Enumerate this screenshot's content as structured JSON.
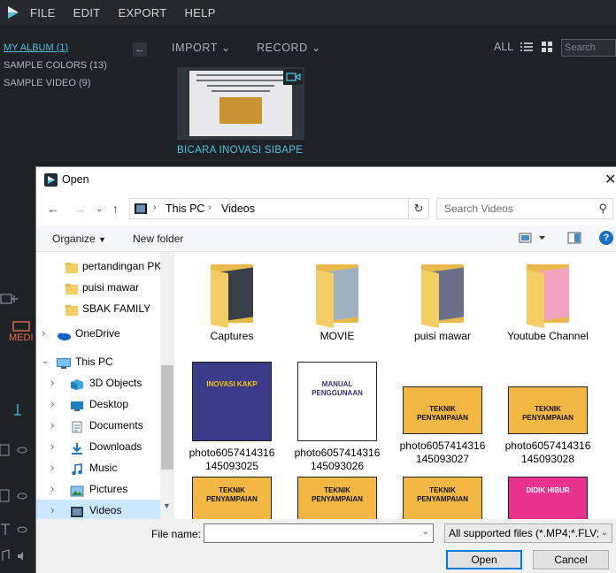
{
  "menubar": {
    "items": [
      "FILE",
      "EDIT",
      "EXPORT",
      "HELP"
    ]
  },
  "library": {
    "items": [
      {
        "label": "MY ALBUM (1)",
        "active": true
      },
      {
        "label": "SAMPLE COLORS (13)",
        "active": false
      },
      {
        "label": "SAMPLE VIDEO (9)",
        "active": false
      }
    ]
  },
  "media": {
    "import_label": "IMPORT",
    "record_label": "RECORD",
    "view_all": "ALL",
    "search_placeholder": "Search",
    "clip_title": "BICARA INOVASI SIBAPE",
    "media_tab": "MEDI"
  },
  "dialog": {
    "title": "Open",
    "breadcrumb": [
      "This PC",
      "Videos"
    ],
    "search_placeholder": "Search Videos",
    "organize_label": "Organize",
    "new_folder_label": "New folder",
    "nav_items": [
      {
        "label": "pertandingan PKB",
        "type": "folder",
        "indent": 1
      },
      {
        "label": "puisi mawar",
        "type": "folder",
        "indent": 1
      },
      {
        "label": "SBAK FAMILY",
        "type": "folder",
        "indent": 1
      },
      {
        "label": "OneDrive",
        "type": "onedrive",
        "indent": 0
      },
      {
        "label": "This PC",
        "type": "pc",
        "indent": 0,
        "expanded": true
      },
      {
        "label": "3D Objects",
        "type": "3d",
        "indent": 1
      },
      {
        "label": "Desktop",
        "type": "desktop",
        "indent": 1
      },
      {
        "label": "Documents",
        "type": "documents",
        "indent": 1
      },
      {
        "label": "Downloads",
        "type": "downloads",
        "indent": 1
      },
      {
        "label": "Music",
        "type": "music",
        "indent": 1
      },
      {
        "label": "Pictures",
        "type": "pictures",
        "indent": 1
      },
      {
        "label": "Videos",
        "type": "videos",
        "indent": 1,
        "selected": true
      }
    ],
    "files": [
      {
        "name": "Captures",
        "kind": "folder",
        "paper": "#3a4048"
      },
      {
        "name": "MOVIE",
        "kind": "folder",
        "paper": "#9fb0c0"
      },
      {
        "name": "puisi mawar",
        "kind": "folder",
        "paper": "#6a6f8a"
      },
      {
        "name": "Youtube Channel",
        "kind": "folder",
        "paper": "#f2a3c0"
      },
      {
        "name": "photo6057414316\n145093025",
        "kind": "image",
        "caption": "INOVASI KAKP",
        "bg": "#3b3b8a",
        "accent": "#f1c40f"
      },
      {
        "name": "photo6057414316\n145093026",
        "kind": "image",
        "caption": "MANUAL PENGGUNAAN",
        "bg": "#ffffff",
        "accent": "#3a2d7a"
      },
      {
        "name": "photo6057414316\n145093027",
        "kind": "image",
        "caption": "TEKNIK PENYAMPAIAN",
        "bg": "#f3b843",
        "accent": "#111111"
      },
      {
        "name": "photo6057414316\n145093028",
        "kind": "image",
        "caption": "TEKNIK PENYAMPAIAN",
        "bg": "#f3b843",
        "accent": "#111111"
      },
      {
        "name": "",
        "kind": "image",
        "caption": "TEKNIK PENYAMPAIAN",
        "bg": "#f3b843",
        "accent": "#111111"
      },
      {
        "name": "",
        "kind": "image",
        "caption": "TEKNIK PENYAMPAIAN",
        "bg": "#f3b843",
        "accent": "#111111"
      },
      {
        "name": "",
        "kind": "image",
        "caption": "TEKNIK PENYAMPAIAN",
        "bg": "#f3b843",
        "accent": "#111111"
      },
      {
        "name": "",
        "kind": "image",
        "caption": "DIDIK HIBUR",
        "bg": "#e8328c",
        "accent": "#ffffff"
      }
    ],
    "filename_label": "File name:",
    "filename_value": "",
    "filter_label": "All supported files (*.MP4;*.FLV;",
    "open_label": "Open",
    "cancel_label": "Cancel"
  },
  "colors": {
    "accent": "#4fc3d8",
    "selection": "#cce8ff",
    "primary_button": "#0078d7"
  }
}
